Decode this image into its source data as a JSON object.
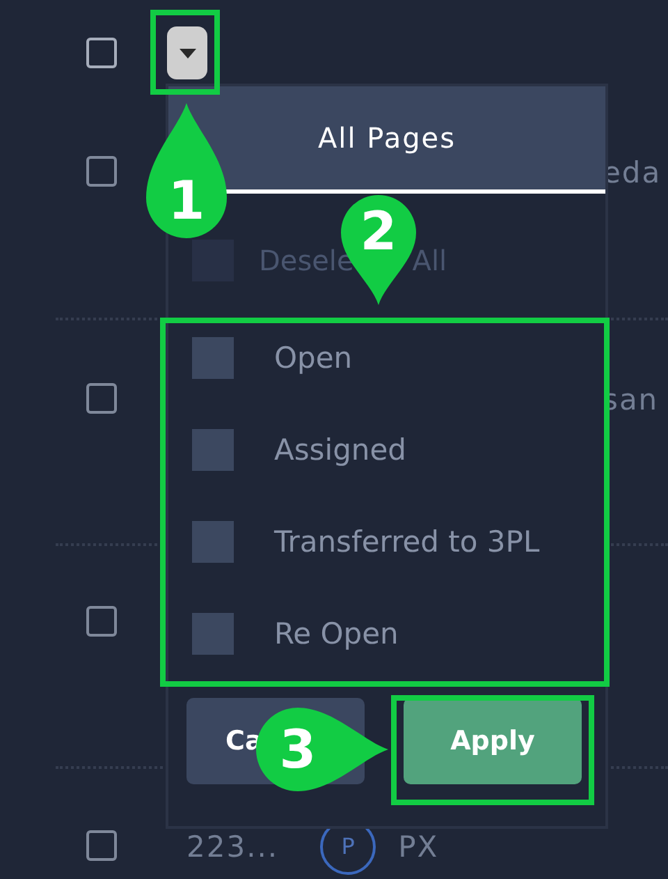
{
  "table": {
    "header_checkbox": {
      "checked": false
    },
    "dropdown_toggle": {
      "expanded": true
    },
    "rows": [
      {
        "checked": false,
        "cells": [
          {
            "kind": "far",
            "text": "eda"
          }
        ]
      },
      {
        "checked": false,
        "cells": [
          {
            "kind": "far",
            "text": "san"
          }
        ]
      },
      {
        "checked": false
      },
      {
        "checked": false,
        "cells": [
          {
            "kind": "id",
            "text": "223..."
          },
          {
            "kind": "avatar",
            "text": "P"
          },
          {
            "kind": "name",
            "text": "PX"
          }
        ]
      }
    ]
  },
  "filter_menu": {
    "title": "All Pages",
    "deselect_all": {
      "checked": false,
      "label_start": "Desele",
      "label_end": "All"
    },
    "options": [
      {
        "label": "Open",
        "checked": false
      },
      {
        "label": "Assigned",
        "checked": false
      },
      {
        "label": "Transferred to 3PL",
        "checked": false
      },
      {
        "label": "Re Open",
        "checked": false
      }
    ],
    "buttons": [
      {
        "kind": "cancel",
        "label": "Ca"
      },
      {
        "kind": "apply",
        "label": "Apply"
      }
    ]
  },
  "callouts": [
    {
      "number": "1"
    },
    {
      "number": "2"
    },
    {
      "number": "3"
    }
  ]
}
